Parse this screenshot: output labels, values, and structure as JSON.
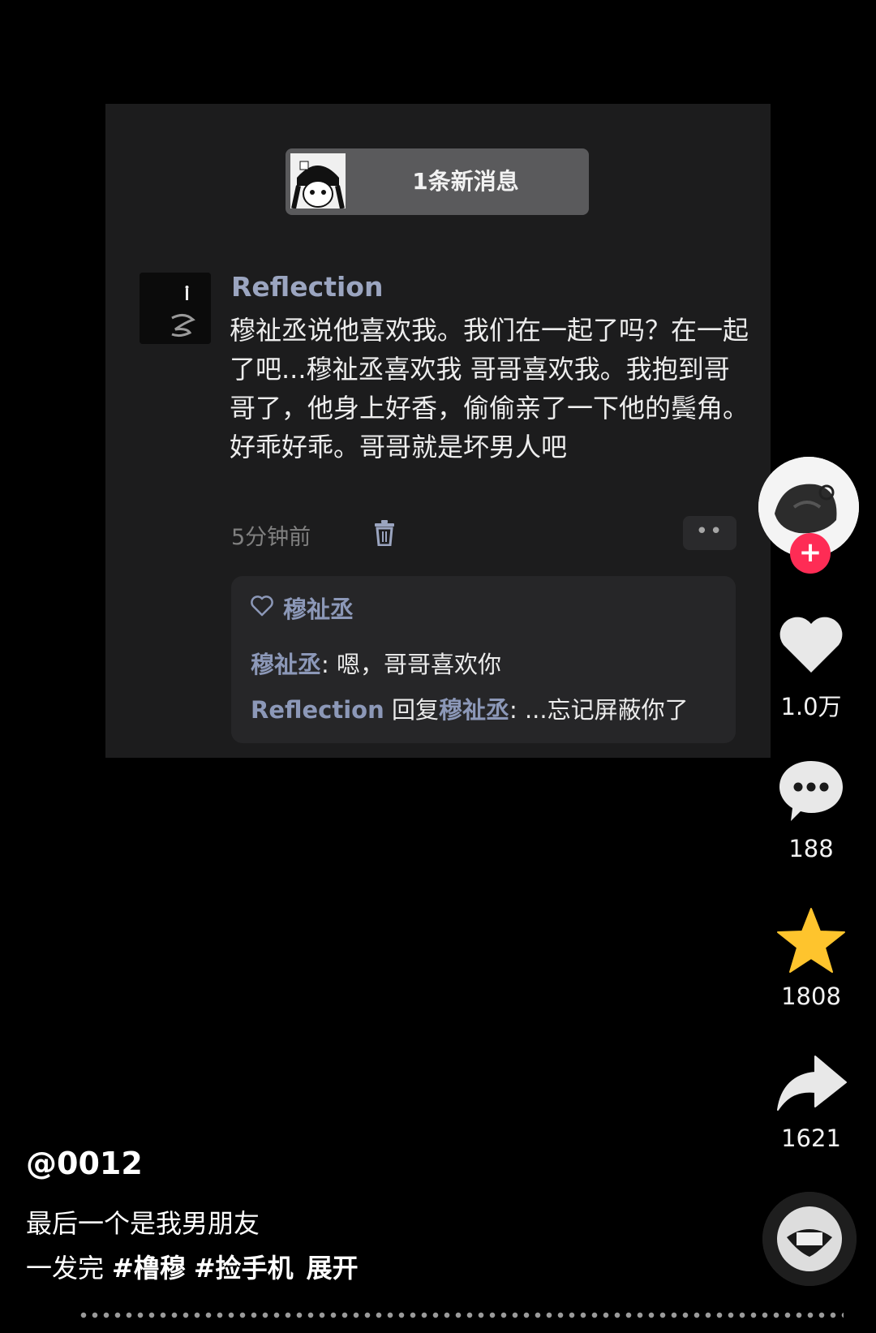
{
  "screenshot": {
    "notice_label": "1条新消息",
    "comment": {
      "username": "Reflection",
      "text": "穆祉丞说他喜欢我。我们在一起了吗？在一起了吧...穆祉丞喜欢我 哥哥喜欢我。我抱到哥哥了，他身上好香，偷偷亲了一下他的鬓角。好乖好乖。哥哥就是坏男人吧",
      "time": "5分钟前",
      "more_label": "••",
      "liked_by": "穆祉丞",
      "reply1_user": "穆祉丞",
      "reply1_sep": ": ",
      "reply1_text": "嗯，哥哥喜欢你",
      "reply2_user": "Reflection",
      "reply2_mid": " 回复",
      "reply2_target": "穆祉丞",
      "reply2_sep": ": ",
      "reply2_text": "...忘记屏蔽你了"
    }
  },
  "sidebar": {
    "follow_label": "+",
    "likes": "1.0万",
    "comments": "188",
    "favorites": "1808",
    "shares": "1621"
  },
  "post": {
    "author": "@0012",
    "line1": "最后一个是我男朋友",
    "line2": "一发完",
    "tags": [
      "#橹穆",
      "#捡手机"
    ],
    "expand": "展开"
  },
  "colors": {
    "accent_blue": "#8c98b8",
    "follow_red": "#fe2c55",
    "star_yellow": "#fec42d"
  }
}
